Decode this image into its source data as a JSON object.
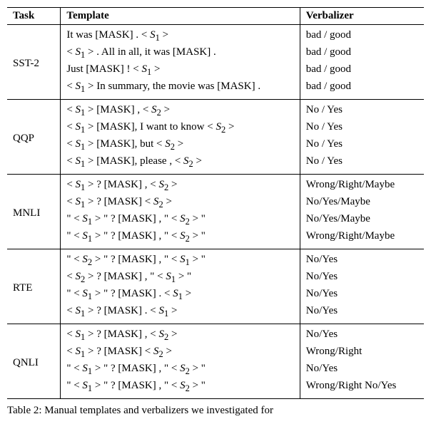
{
  "headers": {
    "task": "Task",
    "template": "Template",
    "verbalizer": "Verbalizer"
  },
  "tasks": [
    {
      "name": "SST-2",
      "rows": [
        {
          "template": "It was [MASK] . < S₁ >",
          "verbalizer": "bad / good"
        },
        {
          "template": "< S₁ > . All in all, it was [MASK] .",
          "verbalizer": "bad / good"
        },
        {
          "template": "Just [MASK] ! < S₁ >",
          "verbalizer": "bad / good"
        },
        {
          "template": "< S₁ >  In summary, the movie was [MASK] .",
          "verbalizer": "bad / good"
        }
      ]
    },
    {
      "name": "QQP",
      "rows": [
        {
          "template": "< S₁ > [MASK] , < S₂ >",
          "verbalizer": "No / Yes"
        },
        {
          "template": "< S₁ > [MASK], I want to know < S₂ >",
          "verbalizer": "No / Yes"
        },
        {
          "template": "< S₁ > [MASK], but < S₂ >",
          "verbalizer": "No / Yes"
        },
        {
          "template": "< S₁ > [MASK], please , < S₂ >",
          "verbalizer": "No / Yes"
        }
      ]
    },
    {
      "name": "MNLI",
      "rows": [
        {
          "template": "< S₁ > ? [MASK] , < S₂ >",
          "verbalizer": "Wrong/Right/Maybe"
        },
        {
          "template": "< S₁ > ? [MASK] < S₂ >",
          "verbalizer": "No/Yes/Maybe"
        },
        {
          "template": "\" < S₁ > \" ? [MASK] , \" < S₂ > \"",
          "verbalizer": "No/Yes/Maybe"
        },
        {
          "template": "\" < S₁ > \" ? [MASK] , \" < S₂ > \"",
          "verbalizer": "Wrong/Right/Maybe"
        }
      ]
    },
    {
      "name": "RTE",
      "rows": [
        {
          "template": "\" < S₂ > \" ? [MASK] , \" < S₁ > \"",
          "verbalizer": "No/Yes"
        },
        {
          "template": "< S₂ > ? [MASK] , \" < S₁ > \"",
          "verbalizer": "No/Yes"
        },
        {
          "template": "\" < S₁ > \" ? [MASK] . < S₁ >",
          "verbalizer": "No/Yes"
        },
        {
          "template": "< S₁ > ? [MASK] . < S₁ >",
          "verbalizer": "No/Yes"
        }
      ]
    },
    {
      "name": "QNLI",
      "rows": [
        {
          "template": "< S₁ > ? [MASK] , < S₂ >",
          "verbalizer": "No/Yes"
        },
        {
          "template": "< S₁ > ? [MASK] < S₂ >",
          "verbalizer": "Wrong/Right"
        },
        {
          "template": "\" < S₁ > \" ? [MASK] , \" < S₂ > \"",
          "verbalizer": "No/Yes"
        },
        {
          "template": "\" < S₁ > \" ? [MASK] , \" < S₂ > \"",
          "verbalizer": "Wrong/Right No/Yes"
        }
      ]
    }
  ],
  "caption": "Table 2: Manual templates and verbalizers we investigated for"
}
